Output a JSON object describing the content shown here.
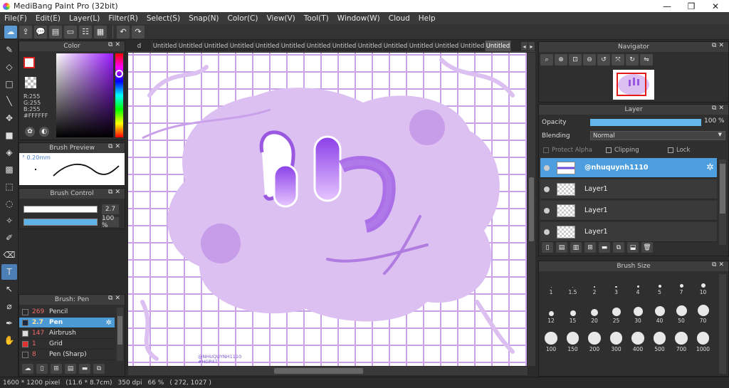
{
  "window": {
    "title": "MediBang Paint Pro (32bit)",
    "minimize": "—",
    "maximize": "❐",
    "close": "✕"
  },
  "menu": [
    "File(F)",
    "Edit(E)",
    "Layer(L)",
    "Filter(R)",
    "Select(S)",
    "Snap(N)",
    "Color(C)",
    "View(V)",
    "Tool(T)",
    "Window(W)",
    "Cloud",
    "Help"
  ],
  "toolbar": {
    "buttons": [
      "cloud-icon",
      "export-icon",
      "comment-icon",
      "message-icon",
      "page-icon",
      "page-list-icon",
      "grid-icon"
    ],
    "undo": "undo-icon",
    "redo": "redo-icon"
  },
  "tools": [
    "pen-icon",
    "eraser-icon",
    "rect-icon",
    "line-icon",
    "move-icon",
    "fill-rect-icon",
    "bucket-icon",
    "gradient-icon",
    "select-rect-icon",
    "lasso-icon",
    "magic-wand-icon",
    "select-pen-icon",
    "select-eraser-icon",
    "text-icon",
    "operation-icon",
    "eyedropper-icon",
    "dropper2-icon",
    "hand-icon"
  ],
  "color_panel": {
    "title": "Color",
    "r": "R:255",
    "g": "G:255",
    "b": "B:255",
    "hex": "#FFFFFF",
    "accent": "#9b1cff"
  },
  "brush_preview": {
    "title": "Brush Preview",
    "size": "° 0.20mm"
  },
  "brush_control": {
    "title": "Brush Control",
    "size_value": "2.7",
    "opacity_value": "100 %",
    "size_fraction": 1.0,
    "opacity_fraction": 1.0
  },
  "brush_list": {
    "title": "Brush: Pen",
    "items": [
      {
        "size": "269",
        "name": "Pencil",
        "color": "#2b2b2b"
      },
      {
        "size": "2.7",
        "name": "Pen",
        "color": "#1e2a40"
      },
      {
        "size": "147",
        "name": "Airbrush",
        "color": "#dddddd"
      },
      {
        "size": "1",
        "name": "Grid",
        "color": "#e03030"
      },
      {
        "size": "8",
        "name": "Pen (Sharp)",
        "color": "#2b2b2b"
      }
    ]
  },
  "tabs": [
    "d",
    "Untitled",
    "Untitled",
    "Untitled",
    "Untitled",
    "Untitled",
    "Untitled",
    "Untitled",
    "Untitled",
    "Untitled",
    "Untitled",
    "Untitled",
    "Untitled",
    "Untitled",
    "Untitled",
    "Untitled"
  ],
  "canvas": {
    "signature_line1": "@NHUQUYNH1110",
    "signature_line2": "#HGP47"
  },
  "navigator": {
    "title": "Navigator"
  },
  "layer_panel": {
    "title": "Layer",
    "opacity_label": "Opacity",
    "opacity_value": "100 %",
    "blending_label": "Blending",
    "blending_value": "Normal",
    "protect_alpha": "Protect Alpha",
    "clipping": "Clipping",
    "lock": "Lock",
    "layers": [
      "@nhuquynh1110",
      "Layer1",
      "Layer1",
      "Layer1"
    ]
  },
  "brush_size": {
    "title": "Brush Size",
    "sizes": [
      "1",
      "1.5",
      "2",
      "3",
      "4",
      "5",
      "7",
      "10",
      "12",
      "15",
      "20",
      "25",
      "30",
      "40",
      "50",
      "70",
      "100",
      "150",
      "200",
      "300",
      "400",
      "500",
      "700",
      "1000"
    ]
  },
  "status": {
    "dimensions": "1600 * 1200 pixel",
    "physical": "(11.6 * 8.7cm)",
    "dpi": "350 dpi",
    "zoom": "66 %",
    "coords": "( 272, 1027 )"
  }
}
